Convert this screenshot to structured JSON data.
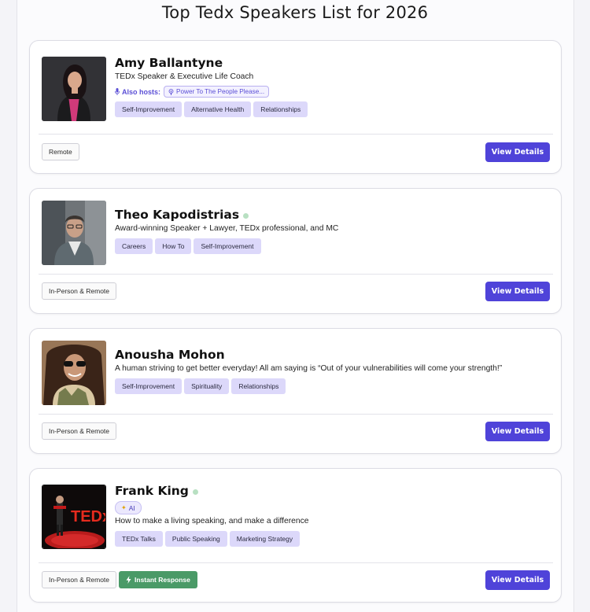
{
  "page": {
    "title": "Top Tedx Speakers List for 2026"
  },
  "speakers": [
    {
      "name": "Amy Ballantyne",
      "tagline": "TEDx Speaker & Executive Life Coach",
      "also_hosts_label": "Also hosts:",
      "podcast": "Power To The People Please...",
      "tags": [
        "Self-Improvement",
        "Alternative Health",
        "Relationships"
      ],
      "modes": [
        "Remote"
      ],
      "button": "View Details"
    },
    {
      "name": "Theo Kapodistrias",
      "tagline": "Award-winning Speaker + Lawyer, TEDx professional, and MC",
      "tags": [
        "Careers",
        "How To",
        "Self-Improvement"
      ],
      "modes": [
        "In-Person & Remote"
      ],
      "button": "View Details"
    },
    {
      "name": "Anousha Mohon",
      "tagline": "A human striving to get better everyday! All am saying is “Out of your vulnerabilities will come your strength!”",
      "tags": [
        "Self-Improvement",
        "Spirituality",
        "Relationships"
      ],
      "modes": [
        "In-Person & Remote"
      ],
      "button": "View Details"
    },
    {
      "name": "Frank King",
      "badge": "AI",
      "tagline": "How to make a living speaking, and make a difference",
      "tags": [
        "TEDx Talks",
        "Public Speaking",
        "Marketing Strategy"
      ],
      "modes": [
        "In-Person & Remote"
      ],
      "instant": "Instant Response",
      "button": "View Details",
      "photo_text": "TEDx"
    }
  ],
  "colors": {
    "accent": "#4f43d9",
    "tag_bg": "#dcd8fa",
    "instant": "#4a9a67",
    "online": "#b8e0c2"
  },
  "icons": [
    "microphone-icon",
    "podcast-icon",
    "sparkle-icon",
    "bolt-icon"
  ]
}
